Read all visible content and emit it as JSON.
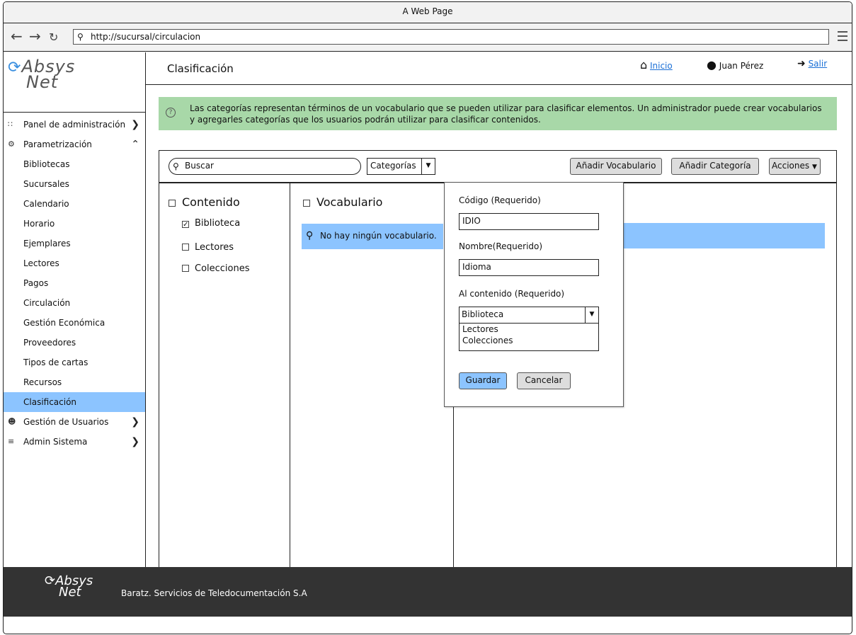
{
  "window": {
    "title": "A Web Page"
  },
  "browser": {
    "url": "http://sucursal/circulacion"
  },
  "logo": {
    "line1": "Absys",
    "line2": "Net"
  },
  "sidebar": {
    "items": [
      {
        "label": "Panel de administración",
        "icon": "dashboard-icon",
        "top": true,
        "chevron": ">"
      },
      {
        "label": "Parametrización",
        "icon": "gears-icon",
        "top": true,
        "chevron": "^"
      },
      {
        "label": "Bibliotecas"
      },
      {
        "label": "Sucursales"
      },
      {
        "label": "Calendario"
      },
      {
        "label": "Horario"
      },
      {
        "label": "Ejemplares"
      },
      {
        "label": "Lectores"
      },
      {
        "label": "Pagos"
      },
      {
        "label": "Circulación"
      },
      {
        "label": "Gestión Económica"
      },
      {
        "label": "Proveedores"
      },
      {
        "label": "Tipos de cartas"
      },
      {
        "label": "Recursos"
      },
      {
        "label": "Clasificación",
        "active": true
      },
      {
        "label": "Gestión de Usuarios",
        "icon": "users-icon",
        "top": true,
        "chevron": ">"
      },
      {
        "label": "Admin Sistema",
        "icon": "stack-icon",
        "top": true,
        "chevron": ">"
      }
    ]
  },
  "header": {
    "title": "Clasificación",
    "home_label": "Inicio",
    "user_name": "Juan Pérez",
    "logout_label": "Salir"
  },
  "info": {
    "text": "Las categorías representan términos de un vocabulario que se pueden utilizar para clasificar elementos. Un administrador puede crear vocabularios y agregarles categorías que los usuarios podrán utilizar para clasificar contenidos."
  },
  "toolbar": {
    "search_label": "Buscar",
    "filter_value": "Categorías",
    "add_vocabulary": "Añadir Vocabulario",
    "add_category": "Añadir Categoría",
    "actions": "Acciones"
  },
  "content_column": {
    "header": "Contenido",
    "items": [
      {
        "label": "Biblioteca",
        "checked": true
      },
      {
        "label": "Lectores",
        "checked": false
      },
      {
        "label": "Colecciones",
        "checked": false
      }
    ]
  },
  "vocabulary_column": {
    "header": "Vocabulario",
    "empty_message": "No hay ningún vocabulario."
  },
  "popup": {
    "code_label": "Código (Requerido)",
    "code_value": "IDIO",
    "name_label": "Nombre(Requerido)",
    "name_value": "Idioma",
    "content_label": "Al contenido (Requerido)",
    "content_selected": "Biblioteca",
    "content_options": [
      "Lectores",
      "Colecciones"
    ],
    "save": "Guardar",
    "cancel": "Cancelar"
  },
  "footer": {
    "logo_line1": "Absys",
    "logo_line2": "Net",
    "company": "Baratz. Servicios de Teledocumentación S.A"
  },
  "colors": {
    "accent": "#8cc4ff",
    "info_bg": "#a8d8a8",
    "footer_bg": "#333333"
  }
}
